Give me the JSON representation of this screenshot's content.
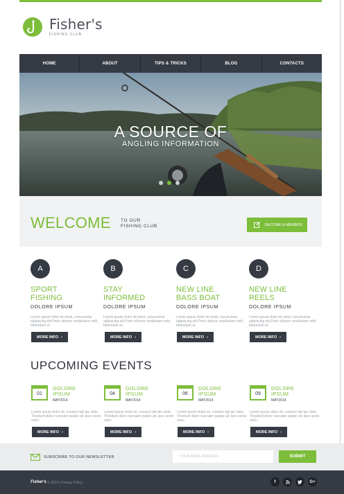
{
  "brand": {
    "name": "Fisher's",
    "tagline": "FISHING CLUB"
  },
  "colors": {
    "accent": "#7cbd3a",
    "dark": "#353a43",
    "light_bg": "#f1f2f3"
  },
  "nav": {
    "items": [
      "HOME",
      "ABOUT",
      "TIPS & TRICKS",
      "BLOG",
      "CONTACTS"
    ]
  },
  "hero": {
    "title": "A SOURCE OF",
    "subtitle": "ANGLING INFORMATION",
    "slides": 3,
    "active_slide": 2
  },
  "welcome": {
    "title": "WELCOME",
    "line1": "TO OUR",
    "line2": "FISHING CLUB",
    "button": "BECOME A MEMBER"
  },
  "features": [
    {
      "letter": "A",
      "title1": "SPORT",
      "title2": "FISHING",
      "sub": "DOLORE IPSUM",
      "text": "Lorem ipsum dolor sit amet, consectetur adipiscing elit.Proin ultrices vestibulum velit, bibendum et.",
      "button": "MORE INFO"
    },
    {
      "letter": "B",
      "title1": "STAY",
      "title2": "INFORMED",
      "sub": "DOLORE IPSUM",
      "text": "Lorem ipsum dolor sit amet, consectetur adipiscing elit.Proin ultrices vestibulum velit, bibendum et.",
      "button": "MORE INFO"
    },
    {
      "letter": "C",
      "title1": "NEW LINE",
      "title2": "BASS BOAT",
      "sub": "DOLORE IPSUM",
      "text": "Lorem ipsum dolor sit amet, consectetur adipiscing elit.Proin ultrices vestibulum velit, bibendum et.",
      "button": "MORE INFO"
    },
    {
      "letter": "D",
      "title1": "NEW LINE",
      "title2": "REELS",
      "sub": "DOLORE IPSUM",
      "text": "Lorem ipsum dolor sit amet, consectetur adipiscing elit.Proin ultrices vestibulum velit, bibendum et.",
      "button": "MORE INFO"
    }
  ],
  "events": {
    "title": "UPCOMING EVENTS",
    "items": [
      {
        "day": "01",
        "title1": "DOLORE",
        "title2": "IPSUM",
        "date": "MAY2014",
        "text": "Lorem ipsum dolor sit, consect tab ipx clete. Tincidunt dolor nuncater pulate ult. ipco secte onec.",
        "button": "MORE INFO"
      },
      {
        "day": "04",
        "title1": "DOLORE",
        "title2": "IPSUM",
        "date": "MAY2014",
        "text": "Lorem ipsum dolor sit, consect tab ipx clete. Tincidunt dolor nuncater pulate ult. ipco secte onec.",
        "button": "MORE INFO"
      },
      {
        "day": "06",
        "title1": "DOLORE",
        "title2": "IPSUM",
        "date": "MAY2014",
        "text": "Lorem ipsum dolor sit, consect tab ipx clete. Tincidunt dolor nuncater pulate ult. ipco secte onec.",
        "button": "MORE INFO"
      },
      {
        "day": "09",
        "title1": "DOLORE",
        "title2": "IPSUM",
        "date": "MAY2014",
        "text": "Lorem ipsum dolor sit, consect tab ipx clete. Tincidunt dolor nuncater pulate ult. ipco secte onec.",
        "button": "MORE INFO"
      }
    ]
  },
  "newsletter": {
    "label": "SUBSCRIBE TO OUR NEWSLETTER",
    "placeholder": "YOUR EMAIL ADDRESS",
    "button": "SUBMIT"
  },
  "footer": {
    "brand": "Fisher's",
    "copyright": "© 2014 | Privacy Policy",
    "social": [
      "f",
      "rss",
      "t",
      "G+"
    ]
  }
}
